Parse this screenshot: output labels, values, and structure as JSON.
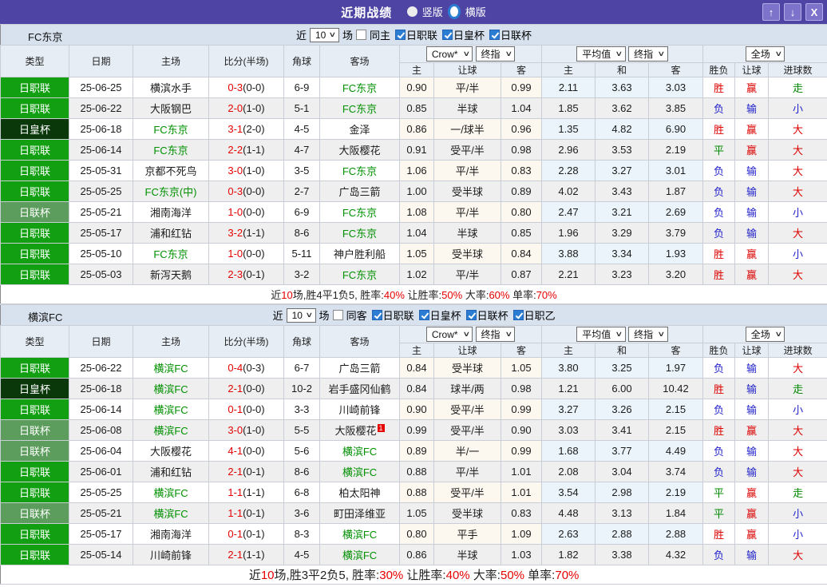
{
  "titlebar": {
    "title": "近期战绩",
    "radio_vertical": "竖版",
    "radio_horizontal": "横版",
    "selected_layout": "横版",
    "up_icon": "↑",
    "down_icon": "↓",
    "close_icon": "X"
  },
  "colors": {
    "titlebar_bg": "#4e44a4",
    "filter_bg": "#d8e2ef",
    "header_bg": "#e7edf5",
    "even_row_bg": "#efefef",
    "crow_tint": "#fcf7ef",
    "avg_tint": "#eaf4fa",
    "score": "#e60000",
    "team": "#009000",
    "red": "#dd0000",
    "green": "#008800",
    "blue": "#2222cc"
  },
  "league_colors": {
    "日职联": "#12a012",
    "日皇杯": "#0a380a",
    "日联杯": "#5c9c5c"
  },
  "outcome_colors": {
    "胜": "#dd0000",
    "赢": "#dd0000",
    "大": "#dd0000",
    "平": "#008800",
    "走": "#008800",
    "负": "#2222cc",
    "输": "#2222cc",
    "小": "#2222cc"
  },
  "table_headers": {
    "type": "类型",
    "date": "日期",
    "home": "主场",
    "score": "比分(半场)",
    "corner": "角球",
    "away": "客场",
    "crow_select": "Crow*",
    "final_select": "终指",
    "avg_select": "平均值",
    "final_select2": "终指",
    "fulltime_select": "全场",
    "sub": [
      "主",
      "让球",
      "客",
      "主",
      "和",
      "客",
      "胜负",
      "让球",
      "进球数"
    ]
  },
  "sections": [
    {
      "team": "FC东京",
      "filter": {
        "near_label": "近",
        "matches_value": "10",
        "matches_label": "场",
        "same_label": "同主",
        "same_checked": false,
        "leagues": [
          {
            "label": "日职联",
            "checked": true
          },
          {
            "label": "日皇杯",
            "checked": true
          },
          {
            "label": "日联杯",
            "checked": true
          }
        ]
      },
      "rows": [
        {
          "league": "日职联",
          "date": "25-06-25",
          "home": "横滨水手",
          "home_hl": false,
          "score": "0-3",
          "half": "(0-0)",
          "corner": "6-9",
          "away": "FC东京",
          "away_hl": true,
          "sup": "",
          "crow": [
            "0.90",
            "平/半",
            "0.99"
          ],
          "avg": [
            "2.11",
            "3.63",
            "3.03"
          ],
          "res": "胜",
          "hres": "赢",
          "goals": "走"
        },
        {
          "league": "日职联",
          "date": "25-06-22",
          "home": "大阪钢巴",
          "home_hl": false,
          "score": "2-0",
          "half": "(1-0)",
          "corner": "5-1",
          "away": "FC东京",
          "away_hl": true,
          "sup": "",
          "crow": [
            "0.85",
            "半球",
            "1.04"
          ],
          "avg": [
            "1.85",
            "3.62",
            "3.85"
          ],
          "res": "负",
          "hres": "输",
          "goals": "小"
        },
        {
          "league": "日皇杯",
          "date": "25-06-18",
          "home": "FC东京",
          "home_hl": true,
          "score": "3-1",
          "half": "(2-0)",
          "corner": "4-5",
          "away": "金泽",
          "away_hl": false,
          "sup": "",
          "crow": [
            "0.86",
            "一/球半",
            "0.96"
          ],
          "avg": [
            "1.35",
            "4.82",
            "6.90"
          ],
          "res": "胜",
          "hres": "赢",
          "goals": "大"
        },
        {
          "league": "日职联",
          "date": "25-06-14",
          "home": "FC东京",
          "home_hl": true,
          "score": "2-2",
          "half": "(1-1)",
          "corner": "4-7",
          "away": "大阪樱花",
          "away_hl": false,
          "sup": "",
          "crow": [
            "0.91",
            "受平/半",
            "0.98"
          ],
          "avg": [
            "2.96",
            "3.53",
            "2.19"
          ],
          "res": "平",
          "hres": "赢",
          "goals": "大"
        },
        {
          "league": "日职联",
          "date": "25-05-31",
          "home": "京都不死鸟",
          "home_hl": false,
          "score": "3-0",
          "half": "(1-0)",
          "corner": "3-5",
          "away": "FC东京",
          "away_hl": true,
          "sup": "",
          "crow": [
            "1.06",
            "平/半",
            "0.83"
          ],
          "avg": [
            "2.28",
            "3.27",
            "3.01"
          ],
          "res": "负",
          "hres": "输",
          "goals": "大"
        },
        {
          "league": "日职联",
          "date": "25-05-25",
          "home": "FC东京(中)",
          "home_hl": true,
          "score": "0-3",
          "half": "(0-0)",
          "corner": "2-7",
          "away": "广岛三箭",
          "away_hl": false,
          "sup": "",
          "crow": [
            "1.00",
            "受半球",
            "0.89"
          ],
          "avg": [
            "4.02",
            "3.43",
            "1.87"
          ],
          "res": "负",
          "hres": "输",
          "goals": "大"
        },
        {
          "league": "日联杯",
          "date": "25-05-21",
          "home": "湘南海洋",
          "home_hl": false,
          "score": "1-0",
          "half": "(0-0)",
          "corner": "6-9",
          "away": "FC东京",
          "away_hl": true,
          "sup": "",
          "crow": [
            "1.08",
            "平/半",
            "0.80"
          ],
          "avg": [
            "2.47",
            "3.21",
            "2.69"
          ],
          "res": "负",
          "hres": "输",
          "goals": "小"
        },
        {
          "league": "日职联",
          "date": "25-05-17",
          "home": "浦和红钻",
          "home_hl": false,
          "score": "3-2",
          "half": "(1-1)",
          "corner": "8-6",
          "away": "FC东京",
          "away_hl": true,
          "sup": "",
          "crow": [
            "1.04",
            "半球",
            "0.85"
          ],
          "avg": [
            "1.96",
            "3.29",
            "3.79"
          ],
          "res": "负",
          "hres": "输",
          "goals": "大"
        },
        {
          "league": "日职联",
          "date": "25-05-10",
          "home": "FC东京",
          "home_hl": true,
          "score": "1-0",
          "half": "(0-0)",
          "corner": "5-11",
          "away": "神户胜利船",
          "away_hl": false,
          "sup": "",
          "crow": [
            "1.05",
            "受半球",
            "0.84"
          ],
          "avg": [
            "3.88",
            "3.34",
            "1.93"
          ],
          "res": "胜",
          "hres": "赢",
          "goals": "小"
        },
        {
          "league": "日职联",
          "date": "25-05-03",
          "home": "新泻天鹅",
          "home_hl": false,
          "score": "2-3",
          "half": "(0-1)",
          "corner": "3-2",
          "away": "FC东京",
          "away_hl": true,
          "sup": "",
          "crow": [
            "1.02",
            "平/半",
            "0.87"
          ],
          "avg": [
            "2.21",
            "3.23",
            "3.20"
          ],
          "res": "胜",
          "hres": "赢",
          "goals": "大"
        }
      ],
      "summary": [
        [
          "近",
          0
        ],
        [
          "10",
          1
        ],
        [
          "场,胜4平1负5, 胜率:",
          0
        ],
        [
          "40%",
          1
        ],
        [
          " 让胜率:",
          0
        ],
        [
          "50%",
          1
        ],
        [
          " 大率:",
          0
        ],
        [
          "60%",
          1
        ],
        [
          " 单率:",
          0
        ],
        [
          "70%",
          1
        ]
      ]
    },
    {
      "team": "横滨FC",
      "filter": {
        "near_label": "近",
        "matches_value": "10",
        "matches_label": "场",
        "same_label": "同客",
        "same_checked": false,
        "leagues": [
          {
            "label": "日职联",
            "checked": true
          },
          {
            "label": "日皇杯",
            "checked": true
          },
          {
            "label": "日联杯",
            "checked": true
          },
          {
            "label": "日职乙",
            "checked": true
          }
        ]
      },
      "rows": [
        {
          "league": "日职联",
          "date": "25-06-22",
          "home": "横滨FC",
          "home_hl": true,
          "score": "0-4",
          "half": "(0-3)",
          "corner": "6-7",
          "away": "广岛三箭",
          "away_hl": false,
          "sup": "",
          "crow": [
            "0.84",
            "受半球",
            "1.05"
          ],
          "avg": [
            "3.80",
            "3.25",
            "1.97"
          ],
          "res": "负",
          "hres": "输",
          "goals": "大"
        },
        {
          "league": "日皇杯",
          "date": "25-06-18",
          "home": "横滨FC",
          "home_hl": true,
          "score": "2-1",
          "half": "(0-0)",
          "corner": "10-2",
          "away": "岩手盛冈仙鹤",
          "away_hl": false,
          "sup": "",
          "crow": [
            "0.84",
            "球半/两",
            "0.98"
          ],
          "avg": [
            "1.21",
            "6.00",
            "10.42"
          ],
          "res": "胜",
          "hres": "输",
          "goals": "走"
        },
        {
          "league": "日职联",
          "date": "25-06-14",
          "home": "横滨FC",
          "home_hl": true,
          "score": "0-1",
          "half": "(0-0)",
          "corner": "3-3",
          "away": "川崎前锋",
          "away_hl": false,
          "sup": "",
          "crow": [
            "0.90",
            "受平/半",
            "0.99"
          ],
          "avg": [
            "3.27",
            "3.26",
            "2.15"
          ],
          "res": "负",
          "hres": "输",
          "goals": "小"
        },
        {
          "league": "日联杯",
          "date": "25-06-08",
          "home": "横滨FC",
          "home_hl": true,
          "score": "3-0",
          "half": "(1-0)",
          "corner": "5-5",
          "away": "大阪樱花",
          "away_hl": false,
          "sup": "1",
          "crow": [
            "0.99",
            "受平/半",
            "0.90"
          ],
          "avg": [
            "3.03",
            "3.41",
            "2.15"
          ],
          "res": "胜",
          "hres": "赢",
          "goals": "大"
        },
        {
          "league": "日联杯",
          "date": "25-06-04",
          "home": "大阪樱花",
          "home_hl": false,
          "score": "4-1",
          "half": "(0-0)",
          "corner": "5-6",
          "away": "横滨FC",
          "away_hl": true,
          "sup": "",
          "crow": [
            "0.89",
            "半/一",
            "0.99"
          ],
          "avg": [
            "1.68",
            "3.77",
            "4.49"
          ],
          "res": "负",
          "hres": "输",
          "goals": "大"
        },
        {
          "league": "日职联",
          "date": "25-06-01",
          "home": "浦和红钻",
          "home_hl": false,
          "score": "2-1",
          "half": "(0-1)",
          "corner": "8-6",
          "away": "横滨FC",
          "away_hl": true,
          "sup": "",
          "crow": [
            "0.88",
            "平/半",
            "1.01"
          ],
          "avg": [
            "2.08",
            "3.04",
            "3.74"
          ],
          "res": "负",
          "hres": "输",
          "goals": "大"
        },
        {
          "league": "日职联",
          "date": "25-05-25",
          "home": "横滨FC",
          "home_hl": true,
          "score": "1-1",
          "half": "(1-1)",
          "corner": "6-8",
          "away": "柏太阳神",
          "away_hl": false,
          "sup": "",
          "crow": [
            "0.88",
            "受平/半",
            "1.01"
          ],
          "avg": [
            "3.54",
            "2.98",
            "2.19"
          ],
          "res": "平",
          "hres": "赢",
          "goals": "走"
        },
        {
          "league": "日联杯",
          "date": "25-05-21",
          "home": "横滨FC",
          "home_hl": true,
          "score": "1-1",
          "half": "(0-1)",
          "corner": "3-6",
          "away": "町田泽维亚",
          "away_hl": false,
          "sup": "",
          "crow": [
            "1.05",
            "受半球",
            "0.83"
          ],
          "avg": [
            "4.48",
            "3.13",
            "1.84"
          ],
          "res": "平",
          "hres": "赢",
          "goals": "小"
        },
        {
          "league": "日职联",
          "date": "25-05-17",
          "home": "湘南海洋",
          "home_hl": false,
          "score": "0-1",
          "half": "(0-1)",
          "corner": "8-3",
          "away": "横滨FC",
          "away_hl": true,
          "sup": "",
          "crow": [
            "0.80",
            "平手",
            "1.09"
          ],
          "avg": [
            "2.63",
            "2.88",
            "2.88"
          ],
          "res": "胜",
          "hres": "赢",
          "goals": "小"
        },
        {
          "league": "日职联",
          "date": "25-05-14",
          "home": "川崎前锋",
          "home_hl": false,
          "score": "2-1",
          "half": "(1-1)",
          "corner": "4-5",
          "away": "横滨FC",
          "away_hl": true,
          "sup": "",
          "crow": [
            "0.86",
            "半球",
            "1.03"
          ],
          "avg": [
            "1.82",
            "3.38",
            "4.32"
          ],
          "res": "负",
          "hres": "输",
          "goals": "大"
        }
      ],
      "summary": [
        [
          "近",
          0
        ],
        [
          "10",
          1
        ],
        [
          "场,胜3平2负5, 胜率:",
          0
        ],
        [
          "30%",
          1
        ],
        [
          " 让胜率:",
          0
        ],
        [
          "40%",
          1
        ],
        [
          " 大率:",
          0
        ],
        [
          "50%",
          1
        ],
        [
          " 单率:",
          0
        ],
        [
          "70%",
          1
        ]
      ]
    }
  ]
}
